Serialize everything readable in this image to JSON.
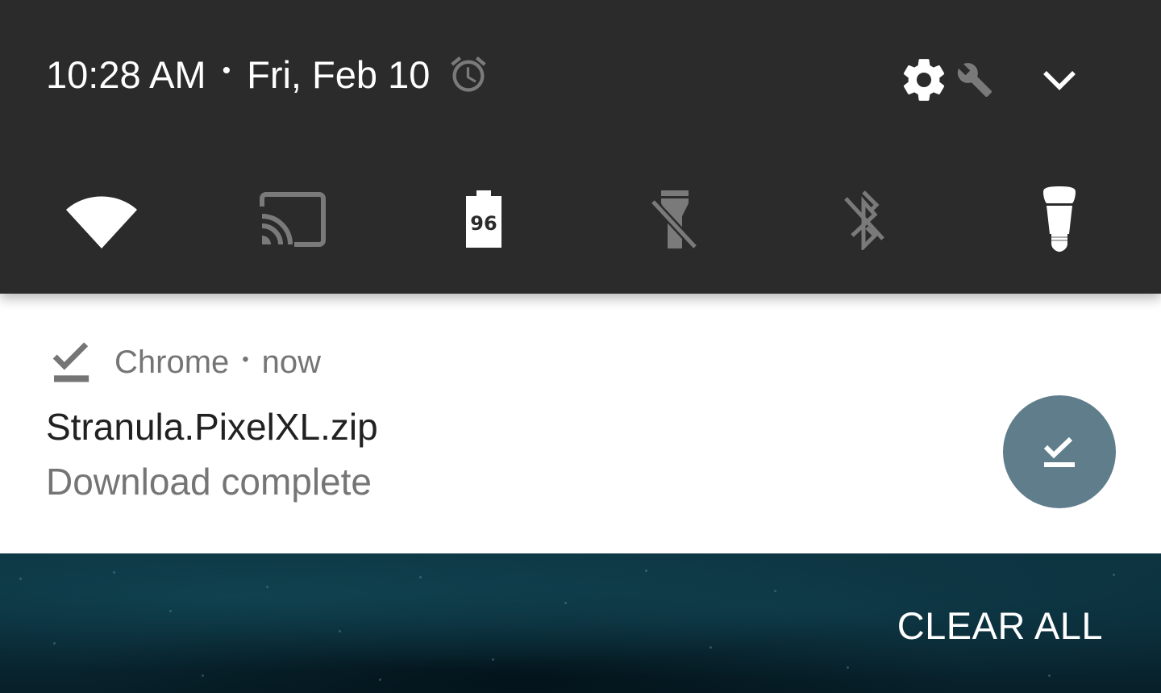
{
  "status_header": {
    "time": "10:28 AM",
    "separator": "•",
    "date": "Fri, Feb 10",
    "alarm_icon": "alarm-clock-icon",
    "settings_icon": "gear-icon",
    "system_ui_tuner_icon": "wrench-icon",
    "expand_icon": "chevron-down-icon"
  },
  "quick_settings": {
    "tiles": [
      {
        "name": "wifi",
        "icon": "wifi-icon",
        "state": "on"
      },
      {
        "name": "cast",
        "icon": "cast-icon",
        "state": "off"
      },
      {
        "name": "battery",
        "icon": "battery-icon",
        "state": "on",
        "label": "96"
      },
      {
        "name": "flashlight",
        "icon": "flashlight-off-icon",
        "state": "off"
      },
      {
        "name": "bluetooth",
        "icon": "bluetooth-disabled-icon",
        "state": "off"
      },
      {
        "name": "hue-bulb",
        "icon": "light-bulb-icon",
        "state": "on"
      }
    ]
  },
  "notification": {
    "app_name": "Chrome",
    "separator": "•",
    "time": "now",
    "title": "Stranula.PixelXL.zip",
    "text": "Download complete",
    "small_icon": "download-done-icon",
    "large_icon": "download-done-icon",
    "accent_color": "#607d8b"
  },
  "actions": {
    "clear_all_label": "CLEAR ALL"
  },
  "colors": {
    "panel_background": "#2b2b2b",
    "tile_active": "#ffffff",
    "tile_inactive": "#7a7a7a",
    "notification_background": "#ffffff"
  }
}
